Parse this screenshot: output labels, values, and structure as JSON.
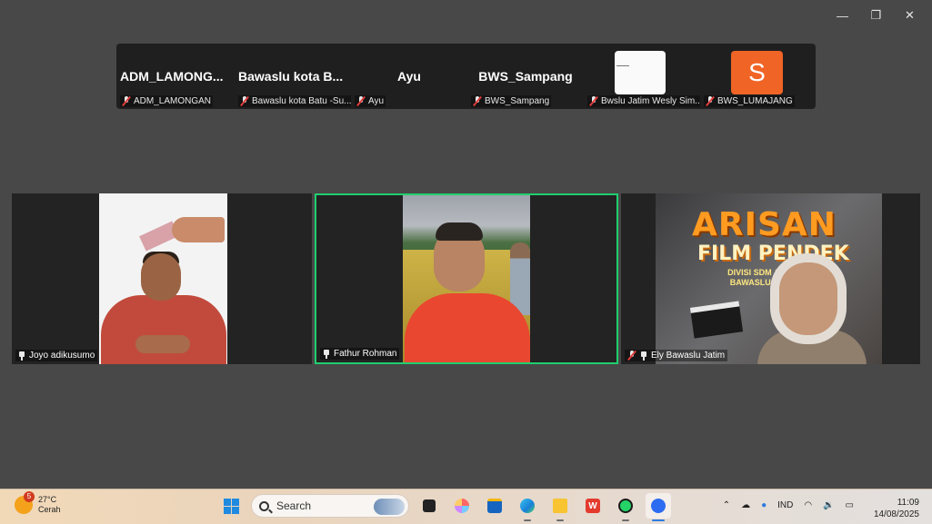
{
  "window_controls": {
    "minimize": "—",
    "restore": "❐",
    "close": "✕"
  },
  "top_strip": [
    {
      "big": "ADM_LAMONG...",
      "label": "ADM_LAMONGAN"
    },
    {
      "big": "Bawaslu kota B...",
      "label": "Bawaslu kota Batu -Su..."
    },
    {
      "big": "Ayu",
      "label": "Ayu"
    },
    {
      "big": "BWS_Sampang",
      "label": "BWS_Sampang"
    },
    {
      "big": "",
      "label": "Bwslu Jatim Wesly Sim..."
    },
    {
      "big": "S",
      "label": "BWS_LUMAJANG"
    }
  ],
  "main_tiles": [
    {
      "name": "Joyo adikusumo"
    },
    {
      "name": "Fathur Rohman"
    },
    {
      "name": "Ely Bawaslu Jatim"
    }
  ],
  "ely_background": {
    "title1": "ARISAN",
    "title2": "FILM PENDEK",
    "subtitle": "DIVISI SDM & O... ASI BAWASLU SE-... ...R"
  },
  "taskbar": {
    "weather_badge": "5",
    "temperature": "27°C",
    "condition": "Cerah",
    "search_placeholder": "Search",
    "language": "IND",
    "time": "11:09",
    "date": "14/08/2025"
  },
  "colors": {
    "active_speaker": "#1fcf6e",
    "avatar_s": "#f06426",
    "muted_mic": "#e03c3c"
  }
}
